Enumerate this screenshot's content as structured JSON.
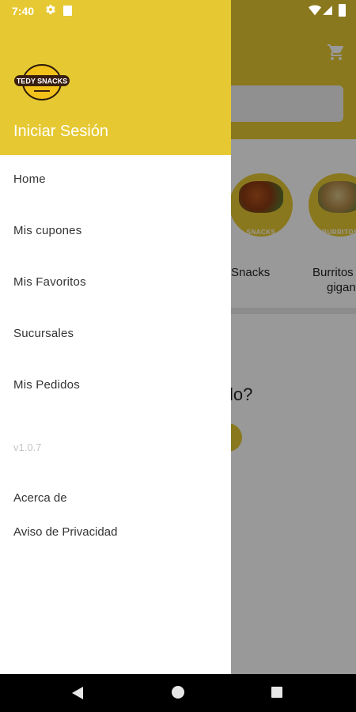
{
  "status_bar": {
    "time": "7:40"
  },
  "drawer": {
    "logo_text": "TEDY SNACKS",
    "login_label": "Iniciar Sesión",
    "menu_items": [
      {
        "label": "Home"
      },
      {
        "label": "Mis cupones"
      },
      {
        "label": "Mis Favoritos"
      },
      {
        "label": "Sucursales"
      },
      {
        "label": "Mis Pedidos"
      }
    ],
    "version": "v1.0.7",
    "info_items": [
      {
        "label": "Acerca de"
      },
      {
        "label": "Aviso de Privacidad"
      }
    ]
  },
  "background": {
    "categories": [
      {
        "tag": "SNACKS",
        "label": "Snacks"
      },
      {
        "tag": "BURRITOS",
        "label_line1": "Burritos",
        "label_line2": "gigan"
      }
    ],
    "question_text": "strado?"
  },
  "colors": {
    "brand_yellow": "#E6C932",
    "scrim": "rgba(0,0,0,0.40)"
  }
}
